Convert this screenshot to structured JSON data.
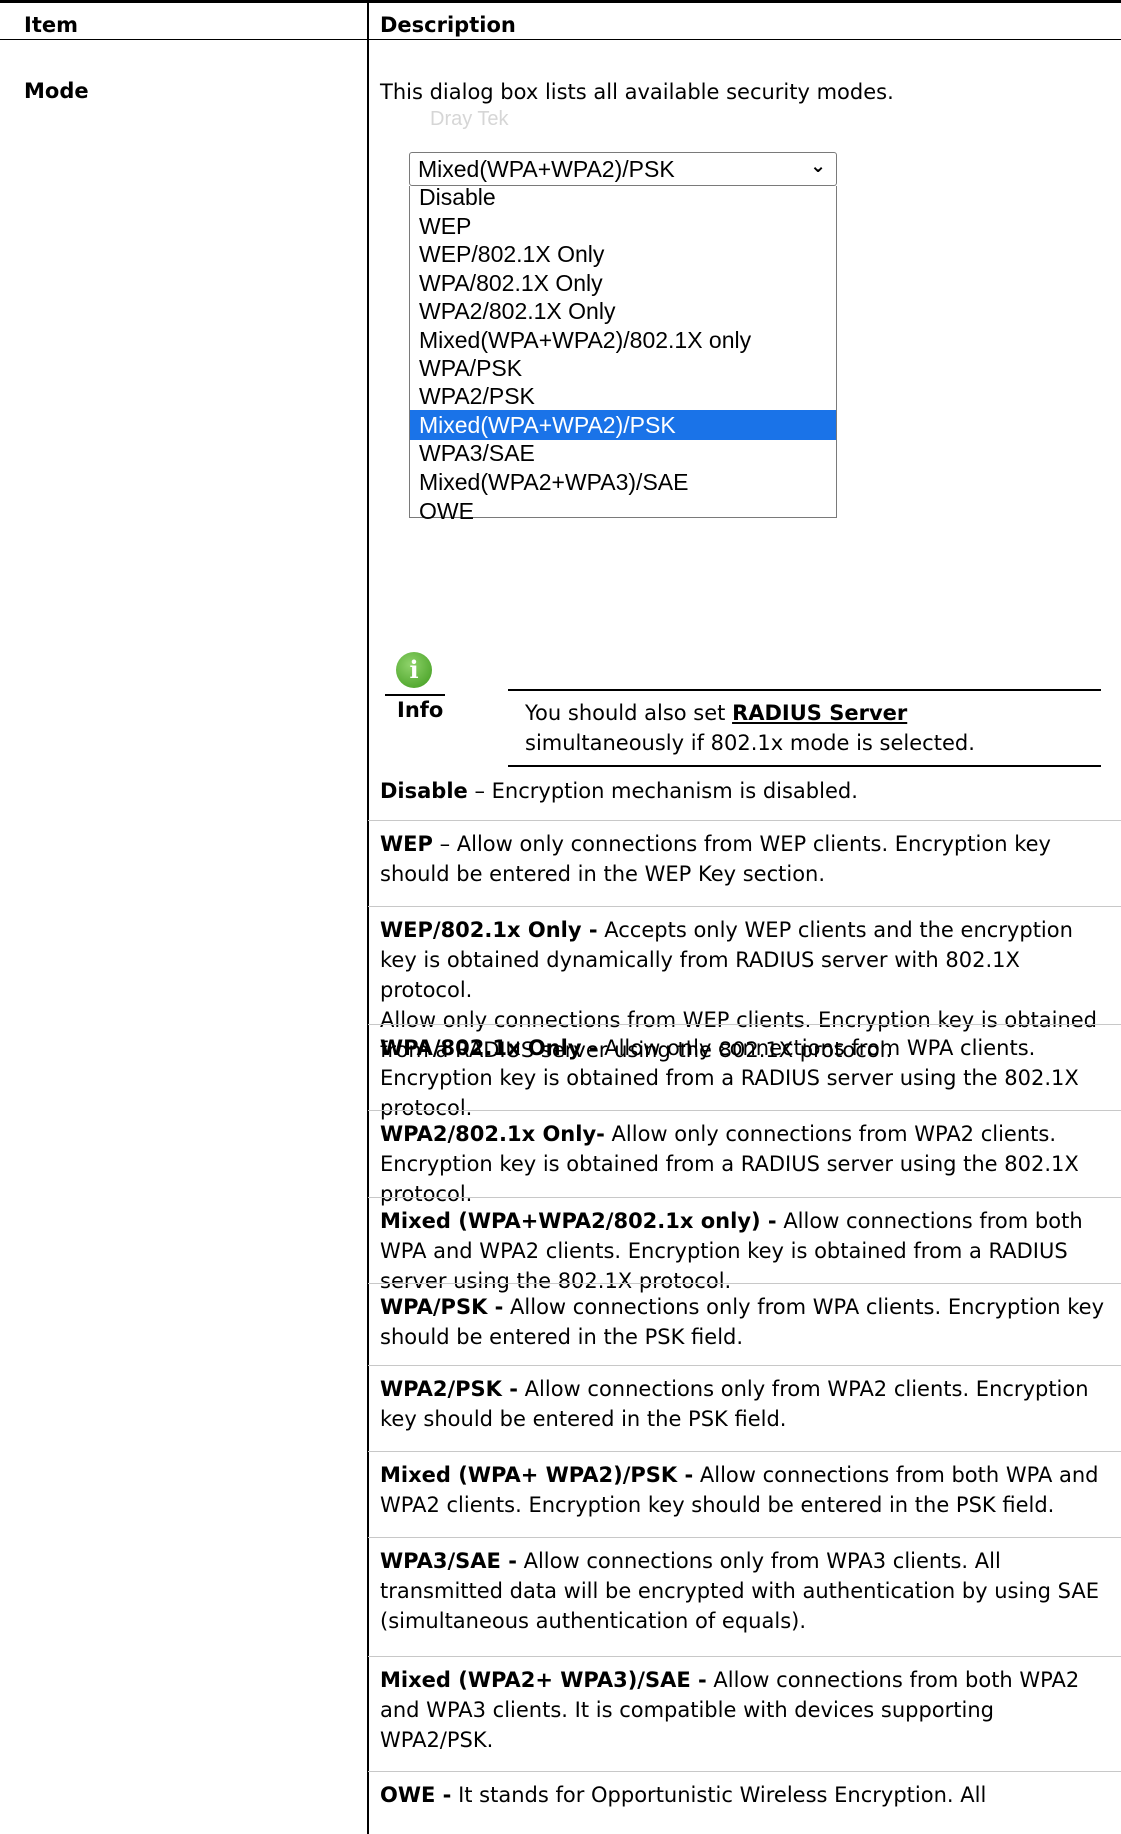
{
  "header": {
    "col_item": "Item",
    "col_description": "Description"
  },
  "row": {
    "item": "Mode",
    "intro": "This dialog box lists all available security modes."
  },
  "dialog": {
    "ghost_top": "Dray Tek",
    "selected_value": "Mixed(WPA+WPA2)/PSK",
    "options": [
      "Disable",
      "WEP",
      "WEP/802.1X Only",
      "WPA/802.1X Only",
      "WPA2/802.1X Only",
      "Mixed(WPA+WPA2)/802.1X only",
      "WPA/PSK",
      "WPA2/PSK",
      "Mixed(WPA+WPA2)/PSK",
      "WPA3/SAE",
      "Mixed(WPA2+WPA3)/SAE",
      "OWE"
    ],
    "highlighted_index": 8
  },
  "info": {
    "label": "Info",
    "pre": "You should also set ",
    "link": "RADIUS Server",
    "post": " simultaneously if 802.1x mode is selected."
  },
  "modes": [
    {
      "term": "Disable",
      "text": " – Encryption mechanism is disabled."
    },
    {
      "term": "WEP",
      "text": " – Allow only connections from WEP clients. Encryption key should be entered in the WEP Key section."
    },
    {
      "term": "WEP/802.1x Only -",
      "text": " Accepts only WEP clients and the encryption key is obtained dynamically from RADIUS server with 802.1X protocol.",
      "extra": "Allow only connections from WEP clients. Encryption key is obtained from a RADIUS server using the 802.1X protocol."
    },
    {
      "term": "WPA/802.1x Only -",
      "text": " Allow only connections from WPA clients. Encryption key is obtained from a RADIUS server using the 802.1X protocol."
    },
    {
      "term": "WPA2/802.1x Only-",
      "text": " Allow only connections from WPA2 clients. Encryption key is obtained from a RADIUS server using the 802.1X protocol."
    },
    {
      "term": "Mixed (WPA+WPA2/802.1x only) -",
      "text": " Allow connections from both WPA and WPA2 clients. Encryption key is obtained from a RADIUS server using the 802.1X protocol."
    },
    {
      "term": "WPA/PSK -",
      "text": " Allow connections only from WPA clients. Encryption key should be entered in the PSK field."
    },
    {
      "term": "WPA2/PSK -",
      "text": " Allow connections only from WPA2 clients. Encryption key should be entered in the PSK field."
    },
    {
      "term": "Mixed (WPA+ WPA2)/PSK -",
      "text": " Allow connections from both WPA and WPA2 clients. Encryption key should be entered in the PSK field."
    },
    {
      "term": "WPA3/SAE -",
      "text": " Allow connections only from WPA3 clients. All transmitted data will be encrypted with authentication by using SAE (simultaneous authentication of equals)."
    },
    {
      "term": "Mixed (WPA2+ WPA3)/SAE -",
      "text": " Allow connections from both WPA2 and WPA3 clients. It is compatible with devices supporting WPA2/PSK."
    },
    {
      "term": "OWE -",
      "text": " It stands for Opportunistic Wireless Encryption. All"
    }
  ]
}
